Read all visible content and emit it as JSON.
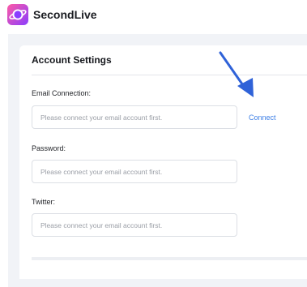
{
  "header": {
    "brand_name": "SecondLive",
    "logo_icon": "planet-logo-icon"
  },
  "settings": {
    "title": "Account Settings",
    "fields": [
      {
        "label": "Email Connection:",
        "placeholder": "Please connect your email account first.",
        "value": ""
      },
      {
        "label": "Password:",
        "placeholder": "Please connect your email account first.",
        "value": ""
      },
      {
        "label": "Twitter:",
        "placeholder": "Please connect your email account first.",
        "value": ""
      }
    ],
    "connect_label": "Connect"
  },
  "annotation": {
    "arrow_icon": "pointer-arrow-icon",
    "arrow_color": "#2f62d8"
  },
  "colors": {
    "page_background": "#f1f3f7",
    "link_blue": "#3d7fe6",
    "logo_purple": "#8a3dff",
    "logo_pink": "#ff5aa5"
  }
}
